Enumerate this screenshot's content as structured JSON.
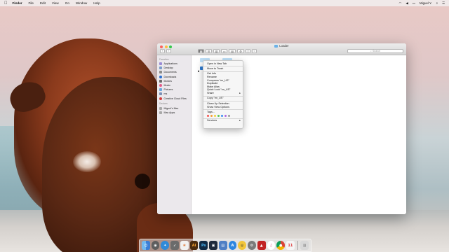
{
  "menubar": {
    "apple": "",
    "app_name": "Finder",
    "items": [
      "File",
      "Edit",
      "View",
      "Go",
      "Window",
      "Help"
    ],
    "user": "Miguel Y.",
    "status_icons": [
      "wifi-icon",
      "volume-icon",
      "battery-icon",
      "spotlight-icon",
      "notification-icon"
    ]
  },
  "window": {
    "title": "Loader",
    "search_placeholder": "Search",
    "sidebar": {
      "favorites_header": "Favorites",
      "favorites": [
        {
          "label": "Applications",
          "icon": "applications-icon",
          "color": "#9b8bd6"
        },
        {
          "label": "Desktop",
          "icon": "desktop-icon",
          "color": "#7b9cc9"
        },
        {
          "label": "Documents",
          "icon": "documents-icon",
          "color": "#8a8a8a"
        },
        {
          "label": "Downloads",
          "icon": "downloads-icon",
          "color": "#2a6fd1"
        },
        {
          "label": "Movies",
          "icon": "movies-icon",
          "color": "#6a6a6a"
        },
        {
          "label": "Music",
          "icon": "music-icon",
          "color": "#e35a87"
        },
        {
          "label": "Pictures",
          "icon": "pictures-icon",
          "color": "#6aa6dd"
        },
        {
          "label": "ms",
          "icon": "home-icon",
          "color": "#7a8fb5"
        },
        {
          "label": "Creative Cloud Files",
          "icon": "creative-cloud-icon",
          "color": "#d23d3d"
        }
      ],
      "devices_header": "Devices",
      "devices": [
        {
          "label": "Miguel's Mac",
          "icon": "computer-icon",
          "color": "#a8a8a8"
        },
        {
          "label": "Mac Apps",
          "icon": "disk-icon",
          "color": "#a8a8a8"
        }
      ]
    }
  },
  "context_menu": {
    "items": [
      {
        "label": "Open in New Tab"
      },
      {
        "sep": true
      },
      {
        "label": "Move to Trash"
      },
      {
        "sep": true
      },
      {
        "label": "Get Info"
      },
      {
        "label": "Rename"
      },
      {
        "label": "Compress \"en_US\""
      },
      {
        "label": "Duplicate"
      },
      {
        "label": "Make Alias"
      },
      {
        "label": "Quick Look \"en_US\""
      },
      {
        "label": "Share",
        "submenu": true
      },
      {
        "sep": true
      },
      {
        "label": "Copy \"en_US\""
      },
      {
        "sep": true
      },
      {
        "label": "Clean Up Selection"
      },
      {
        "label": "Show View Options"
      },
      {
        "sep": true
      },
      {
        "label": "Tags..."
      }
    ],
    "tag_colors": [
      "#f4544f",
      "#f59b38",
      "#f2d23a",
      "#5ac454",
      "#3d8ff0",
      "#b06adf",
      "#9a9a9a"
    ],
    "services_label": "Services"
  },
  "dock": {
    "apps": [
      {
        "name": "finder-icon",
        "color": "#3b8ee8",
        "glyph": "☺"
      },
      {
        "name": "launchpad-icon",
        "color": "#8a8a8a",
        "glyph": "◉"
      },
      {
        "name": "safari-icon",
        "color": "#2f8ad9",
        "glyph": "✦"
      },
      {
        "name": "rocket-icon",
        "color": "#6b6b6b",
        "glyph": "➶"
      },
      {
        "name": "photos-icon",
        "color": "#e6e6e6",
        "glyph": "❀"
      },
      {
        "name": "illustrator-icon",
        "color": "#4a2b0d",
        "glyph": "Ai"
      },
      {
        "name": "photoshop-icon",
        "color": "#0f2a44",
        "glyph": "Ps"
      },
      {
        "name": "quicktime-icon",
        "color": "#1f2a3a",
        "glyph": "▣"
      },
      {
        "name": "preview-icon",
        "color": "#4e7fc4",
        "glyph": "▤"
      },
      {
        "name": "app-store-icon",
        "color": "#2d86e0",
        "glyph": "A"
      },
      {
        "name": "chrome-icon",
        "color": "#f2c53a",
        "glyph": "◎"
      },
      {
        "name": "settings-icon",
        "color": "#7a7a7a",
        "glyph": "⚙"
      },
      {
        "name": "acrobat-icon",
        "color": "#c22424",
        "glyph": "▲"
      },
      {
        "name": "itunes-icon",
        "color": "#e75a8f",
        "glyph": "♫"
      },
      {
        "name": "google-chrome-icon",
        "color": "#3a9a4a",
        "glyph": "◉"
      },
      {
        "name": "calendar-icon",
        "color": "#f5f5f5",
        "glyph": "11"
      },
      {
        "name": "trash-icon",
        "color": "#d8d8d8",
        "glyph": "🗑"
      }
    ]
  }
}
